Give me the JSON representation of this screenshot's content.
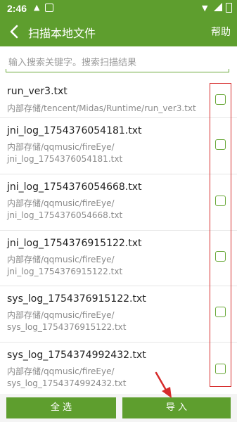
{
  "status_bar": {
    "time": "2:46"
  },
  "header": {
    "title": "扫描本地文件",
    "help_label": "帮助"
  },
  "search": {
    "placeholder": "输入搜索关键字。搜索扫描结果"
  },
  "files": [
    {
      "name": "run_ver3.txt",
      "path_lines": [
        "内部存储/tencent/Midas/Runtime/run_ver3.txt"
      ]
    },
    {
      "name": "jni_log_1754376054181.txt",
      "path_lines": [
        "内部存储/qqmusic/fireEye/",
        "jni_log_1754376054181.txt"
      ]
    },
    {
      "name": "jni_log_1754376054668.txt",
      "path_lines": [
        "内部存储/qqmusic/fireEye/",
        "jni_log_1754376054668.txt"
      ]
    },
    {
      "name": "jni_log_1754376915122.txt",
      "path_lines": [
        "内部存储/qqmusic/fireEye/",
        "jni_log_1754376915122.txt"
      ]
    },
    {
      "name": "sys_log_1754376915122.txt",
      "path_lines": [
        "内部存储/qqmusic/fireEye/",
        "sys_log_1754376915122.txt"
      ]
    },
    {
      "name": "sys_log_1754374992432.txt",
      "path_lines": [
        "内部存储/qqmusic/fireEye/",
        "sys_log_1754374992432.txt"
      ]
    }
  ],
  "actions": {
    "select_all_label": "全 选",
    "import_label": "导 入"
  },
  "colors": {
    "primary": "#5e9e2e",
    "highlight_box": "#d62b2b"
  }
}
